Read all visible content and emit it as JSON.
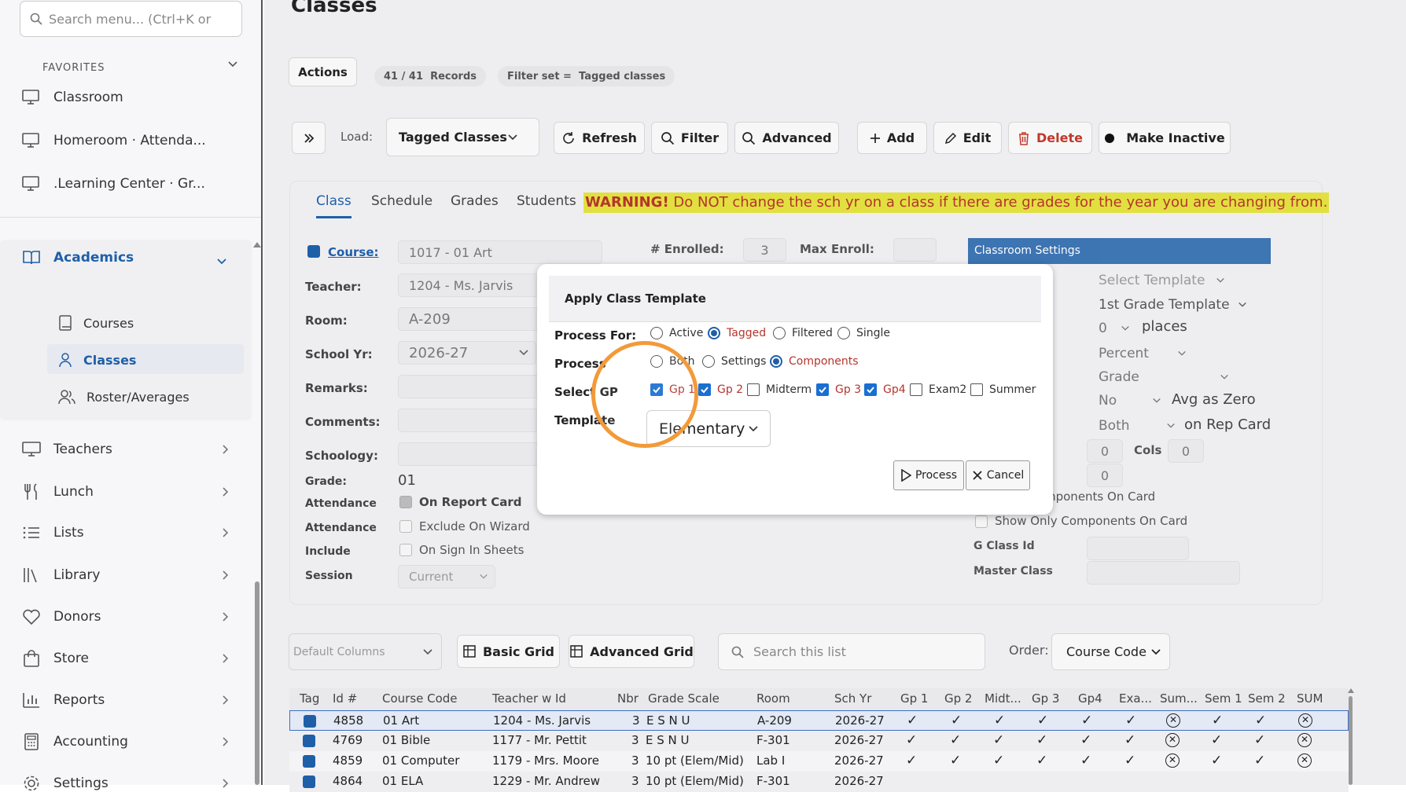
{
  "sidebar": {
    "search_placeholder": "Search menu... (Ctrl+K or",
    "favorites_title": "FAVORITES",
    "favorites": [
      "Classroom",
      "Homeroom · Attenda...",
      ".Learning Center · Gr..."
    ],
    "academics_label": "Academics",
    "academics_sub": [
      "Courses",
      "Classes",
      "Roster/Averages"
    ],
    "nav": [
      "Teachers",
      "Lunch",
      "Lists",
      "Library",
      "Donors",
      "Store",
      "Reports",
      "Accounting",
      "Settings"
    ]
  },
  "page": {
    "title": "Classes",
    "actions_label": "Actions",
    "record_count": "41",
    "record_total": "41",
    "records_label": "Records",
    "filter_set_label": "Filter set =",
    "filter_set_value": "Tagged classes"
  },
  "toolbar": {
    "load_label": "Load:",
    "load_value": "Tagged Classes",
    "refresh": "Refresh",
    "filter": "Filter",
    "advanced": "Advanced",
    "add": "Add",
    "edit": "Edit",
    "delete": "Delete",
    "make_inactive": "Make Inactive"
  },
  "tabs": [
    "Class",
    "Schedule",
    "Grades",
    "Students"
  ],
  "warning": {
    "bold": "WARNING!",
    "text": " Do NOT change the sch yr on a class if there are grades for the year you are changing from."
  },
  "form": {
    "course_label": "Course:",
    "course_value": "1017 - 01 Art",
    "enrolled_label": "# Enrolled:",
    "enrolled_value": "3",
    "max_enroll_label": "Max Enroll:",
    "teacher_label": "Teacher:",
    "teacher_value": "1204 - Ms. Jarvis",
    "room_label": "Room:",
    "room_value": "A-209",
    "school_yr_label": "School Yr:",
    "school_yr_value": "2026-27",
    "remarks_label": "Remarks:",
    "comments_label": "Comments:",
    "schoology_label": "Schoology:",
    "grade_label": "Grade:",
    "grade_value": "01",
    "attendance_label": "Attendance",
    "on_report_card": "On Report Card",
    "attendance2_label": "Attendance",
    "exclude_on_wizard": "Exclude On Wizard",
    "include_label": "Include",
    "on_sign_in_sheets": "On Sign In Sheets",
    "session_label": "Session",
    "session_value": "Current"
  },
  "right_settings": {
    "header": "Classroom Settings",
    "select_template": "Select Template",
    "first_grade_template": "1st Grade Template",
    "places_value": "0",
    "places_label": "places",
    "percent": "Percent",
    "grade": "Grade",
    "no": "No",
    "avg_as_zero": "Avg as Zero",
    "both": "Both",
    "on_rep_card": "on Rep Card",
    "cols_a": "0",
    "cols_label": "Cols",
    "cols_b": "0",
    "third_zero": "0",
    "components_on_card": "mponents On Card",
    "show_only_components": "Show Only Components On Card",
    "g_class_id": "G Class Id",
    "master_class": "Master Class"
  },
  "modal": {
    "title": "Apply Class Template",
    "process_for_label": "Process For:",
    "process_for_options": [
      "Active",
      "Tagged",
      "Filtered",
      "Single"
    ],
    "process_label": "Process",
    "process_options": [
      "Both",
      "Settings",
      "Components"
    ],
    "select_gp_label": "Select GP",
    "gp_options": [
      "Gp 1",
      "Gp 2",
      "Midterm",
      "Gp 3",
      "Gp4",
      "Exam2",
      "Summer"
    ],
    "template_label": "Template",
    "template_value": "Elementary",
    "process_button": "Process",
    "cancel_button": "Cancel"
  },
  "grid_toolbar": {
    "columns_value": "Default Columns",
    "basic_grid": "Basic Grid",
    "advanced_grid": "Advanced Grid",
    "search_placeholder": "Search this list",
    "order_label": "Order:",
    "order_value": "Course Code"
  },
  "grid": {
    "headers": [
      "Tag",
      "Id #",
      "Course Code",
      "Teacher w Id",
      "Nbr",
      "Grade Scale",
      "Room",
      "Sch Yr",
      "Gp 1",
      "Gp 2",
      "Midt...",
      "Gp 3",
      "Gp4",
      "Exa...",
      "Sum...",
      "Sem 1",
      "Sem 2",
      "SUM"
    ],
    "rows": [
      {
        "id": "4858",
        "course": "01 Art",
        "teacher": "1204 - Ms. Jarvis",
        "nbr": "3",
        "scale": "E S N U",
        "room": "A-209",
        "yr": "2026-27"
      },
      {
        "id": "4769",
        "course": "01 Bible",
        "teacher": "1177 - Mr. Pettit",
        "nbr": "3",
        "scale": "E S N U",
        "room": "F-301",
        "yr": "2026-27"
      },
      {
        "id": "4859",
        "course": "01 Computer",
        "teacher": "1179 - Mrs. Moore",
        "nbr": "3",
        "scale": "10 pt (Elem/Mid)",
        "room": "Lab I",
        "yr": "2026-27"
      },
      {
        "id": "4864",
        "course": "01 ELA",
        "teacher": "1229 - Mr. Andrew",
        "nbr": "3",
        "scale": "10 pt (Elem/Mid)",
        "room": "F-301",
        "yr": "2026-27"
      }
    ]
  }
}
